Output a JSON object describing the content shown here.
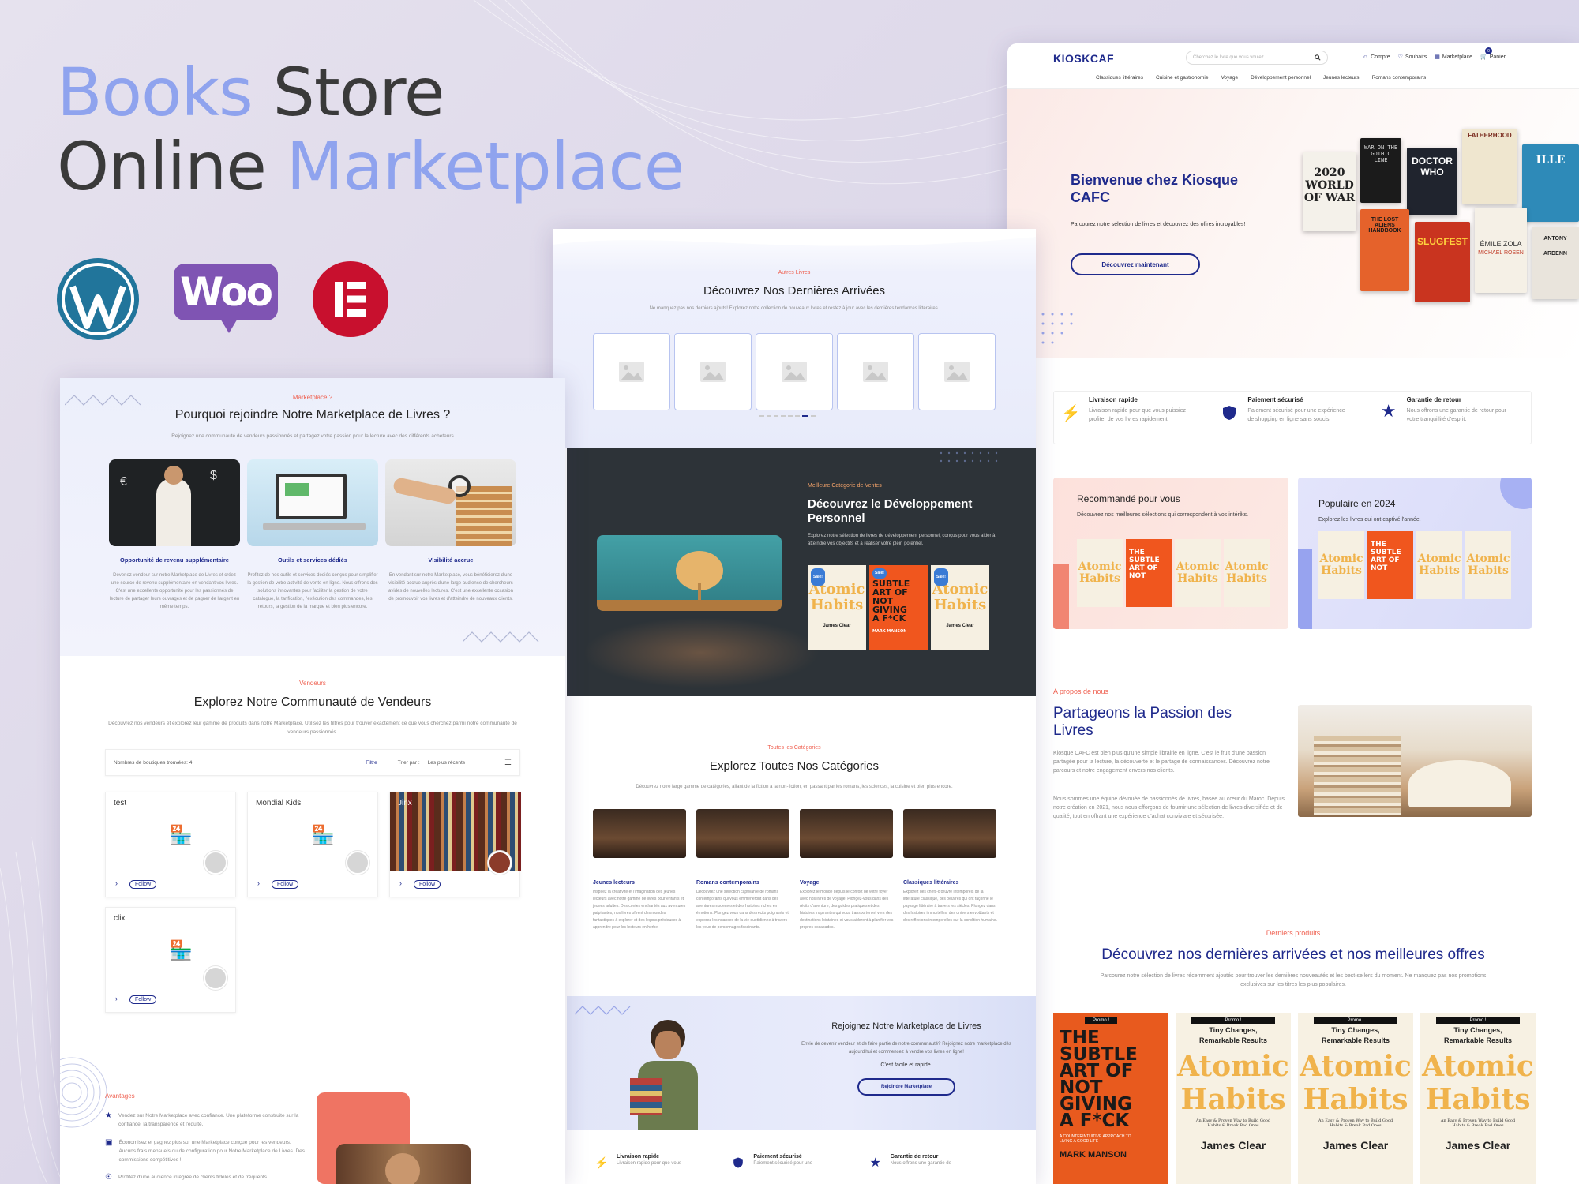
{
  "hero": {
    "line1_accent": "Books",
    "line1_rest": " Store",
    "line2_rest": "Online ",
    "line2_accent": "Marketplace"
  },
  "icons": [
    "wordpress-icon",
    "woocommerce-icon",
    "elementor-icon"
  ],
  "woo_label": "Woo",
  "colors": {
    "accent": "#8fa3ee",
    "navy": "#1f2a8c",
    "coral": "#ef5f4f",
    "dark_section": "#2d3338"
  },
  "left": {
    "kicker": "Marketplace ?",
    "title": "Pourquoi rejoindre Notre Marketplace de Livres ?",
    "subtitle": "Rejoignez une communauté de vendeurs passionnés et partagez votre passion pour la lecture avec des différents acheteurs",
    "features": [
      {
        "title": "Opportunité de revenu supplémentaire",
        "text": "Devenez vendeur sur notre Marketplace de Livres et créez une source de revenu supplémentaire en vendant vos livres. C'est une excellente opportunité pour les passionnés de lecture de partager leurs ouvrages et de gagner de l'argent en même temps."
      },
      {
        "title": "Outils et services dédiés",
        "text": "Profitez de nos outils et services dédiés conçus pour simplifier la gestion de votre activité de vente en ligne. Nous offrons des solutions innovantes pour faciliter la gestion de votre catalogue, la tarification, l'exécution des commandes, les retours, la gestion de la marque et bien plus encore."
      },
      {
        "title": "Visibilité accrue",
        "text": "En vendant sur notre Marketplace, vous bénéficierez d'une visibilité accrue auprès d'une large audience de chercheurs avides de nouvelles lectures. C'est une excellente occasion de promouvoir vos livres et d'atteindre de nouveaux clients."
      }
    ],
    "vendors_kicker": "Vendeurs",
    "vendors_title": "Explorez Notre Communauté de Vendeurs",
    "vendors_sub": "Découvrez nos vendeurs et explorez leur gamme de produits dans notre Marketplace. Utilisez les filtres pour trouver exactement ce que vous cherchez parmi notre communauté de vendeurs passionnés.",
    "toolbar": {
      "count": "Nombres de boutiques trouvées: 4",
      "filter": "Filtre",
      "sort_label": "Trier par :",
      "sort_value": "Les plus récents"
    },
    "vendors": [
      {
        "name": "test",
        "follow": "Follow"
      },
      {
        "name": "Mondial Kids",
        "follow": "Follow"
      },
      {
        "name": "Jinx",
        "follow": "Follow"
      },
      {
        "name": "clix",
        "follow": "Follow"
      }
    ],
    "adv_kicker": "Avantages",
    "advantages": [
      "Vendez sur Notre Marketplace avec confiance. Une plateforme construite sur la confiance, la transparence et l'équité.",
      "Économisez et gagnez plus sur une Marketplace conçue pour les vendeurs. Aucuns frais mensuels ou de configuration pour Notre Marketplace de Livres. Des commissions compétitives !",
      "Profitez d'une audience intégrée de clients fidèles et de fréquents"
    ]
  },
  "middle": {
    "kicker": "Autres Livres",
    "title": "Découvrez Nos Dernières Arrivées",
    "subtitle": "Ne manquez pas nos derniers ajouts! Explorez notre collection de nouveaux livres et restez à jour avec les dernières tendances littéraires.",
    "dev_kicker": "Meilleure Catégorie de Ventes",
    "dev_title": "Découvrez le Développement Personnel",
    "dev_text": "Explorez notre sélection de livres de développement personnel, conçus pour vous aider à atteindre vos objectifs et à réaliser votre plein potentiel.",
    "cat_kicker": "Toutes les Catégories",
    "cat_title": "Explorez Toutes Nos Catégories",
    "cat_sub": "Découvrez notre large gamme de catégories, allant de la fiction à la non-fiction, en passant par les romans, les sciences, la cuisine et bien plus encore.",
    "categories": [
      {
        "name": "Jeunes lecteurs",
        "text": "Inspirez la créativité et l'imagination des jeunes lecteurs avec notre gamme de livres pour enfants et jeunes adultes. Des contes enchantés aux aventures palpitantes, nos livres offrent des mondes fantastiques à explorer et des leçons précieuses à apprendre pour les lecteurs en herbe."
      },
      {
        "name": "Romans contemporains",
        "text": "Découvrez une sélection captivante de romans contemporains qui vous emmèneront dans des aventures modernes et des histoires riches en émotions. Plongez vous dans des récits poignants et explorez les nuances de la vie quotidienne à travers les yeux de personnages fascinants."
      },
      {
        "name": "Voyage",
        "text": "Explorez le monde depuis le confort de votre foyer avec nos livres de voyage. Plongez-vous dans des récits d'aventure, des guides pratiques et des histoires inspirantes qui vous transporteront vers des destinations lointaines et vous aideront à planifier vos propres escapades."
      },
      {
        "name": "Classiques littéraires",
        "text": "Explorez des chefs-d'œuvre intemporels de la littérature classique, des oeuvres qui ont façonné le paysage littéraire à travers les siècles. Plongez dans des histoires immortelles, des univers envoûtants et des réflexions intemporelles sur la condition humaine."
      }
    ],
    "join_title": "Rejoignez Notre Marketplace de Livres",
    "join_text": "Envie de devenir vendeur et de faire partie de notre communauté? Rejoignez notre marketplace dès aujourd'hui et commencez à vendre vos livres en ligne!",
    "join_easy": "C'est facile et rapide.",
    "join_button": "Rejoindre Marketplace",
    "features": [
      {
        "title": "Livraison rapide",
        "text": "Livraison rapide pour que vous"
      },
      {
        "title": "Paiement sécurisé",
        "text": "Paiement sécurisé pour une"
      },
      {
        "title": "Garantie de retour",
        "text": "Nous offrons une garantie de"
      }
    ]
  },
  "right": {
    "logo": "KIOSKCAF",
    "search_placeholder": "Cherchez le livre que vous voulez",
    "header_links": [
      "Compte",
      "Souhaits",
      "Marketplace",
      "Panier"
    ],
    "cart_count": "0",
    "nav": [
      "Classiques littéraires",
      "Cuisine et gastronomie",
      "Voyage",
      "Développement personnel",
      "Jeunes lecteurs",
      "Romans contemporains"
    ],
    "hero_title": "Bienvenue chez Kiosque CAFC",
    "hero_text": "Parcourez notre sélection de livres et découvrez des offres incroyables!",
    "hero_button": "Découvrez maintenant",
    "hero_books": [
      "2020 WORLD OF WAR",
      "WAR ON THE GOTHIC LINE",
      "DOCTOR WHO",
      "FATHERHOOD",
      "ILLE",
      "THE LOST ALIENS HANDBOOK",
      "SLUGFEST",
      "ÉMILE ZOLA",
      "MICHAEL ROSEN",
      "ANTONY",
      "ARDENN"
    ],
    "features": [
      {
        "title": "Livraison rapide",
        "text": "Livraison rapide pour que vous puissiez profiter de vos livres rapidement."
      },
      {
        "title": "Paiement sécurisé",
        "text": "Paiement sécurisé pour une expérience de shopping en ligne sans soucis."
      },
      {
        "title": "Garantie de retour",
        "text": "Nous offrons une garantie de retour pour votre tranquillité d'esprit."
      }
    ],
    "promo1_title": "Recommandé pour vous",
    "promo1_text": "Découvrez nos meilleures sélections qui correspondent à vos intérêts.",
    "promo2_title": "Populaire en 2024",
    "promo2_text": "Explorez les livres qui ont captivé l'année.",
    "sale_badge": "Sale!",
    "about_kicker": "A propos de nous",
    "about_title": "Partageons la Passion des Livres",
    "about_p1": "Kiosque CAFC est bien plus qu'une simple librairie en ligne. C'est le fruit d'une passion partagée pour la lecture, la découverte et le partage de connaissances. Découvrez notre parcours et notre engagement envers nos clients.",
    "about_p2": "Nous sommes une équipe dévouée de passionnés de livres, basée au cœur du Maroc. Depuis notre création en 2021, nous nous efforçons de fournir une sélection de livres diversifiée et de qualité, tout en offrant une expérience d'achat conviviale et sécurisée.",
    "latest_kicker": "Derniers produits",
    "latest_title": "Découvrez nos dernières arrivées et nos meilleures offres",
    "latest_sub": "Parcourez notre sélection de livres récemment ajoutés pour trouver les dernières nouveautés et les best-sellers du moment. Ne manquez pas nos promotions exclusives sur les titres les plus populaires.",
    "promo_badge": "Promo !",
    "book_sa_lines": [
      "THE",
      "SUBTLE",
      "ART OF",
      "NOT",
      "GIVING",
      "A F*CK"
    ],
    "book_sa_sub": "A COUNTERINTUITIVE APPROACH TO LIVING A GOOD LIFE",
    "book_sa_author": "MARK MANSON",
    "book_ah_top": "Tiny Changes, Remarkable Results",
    "book_ah_w1": "Atomic",
    "book_ah_w2": "Habits",
    "book_ah_sub": "An Easy & Proven Way to Build Good Habits & Break Bad Ones",
    "book_ah_author": "James Clear"
  }
}
